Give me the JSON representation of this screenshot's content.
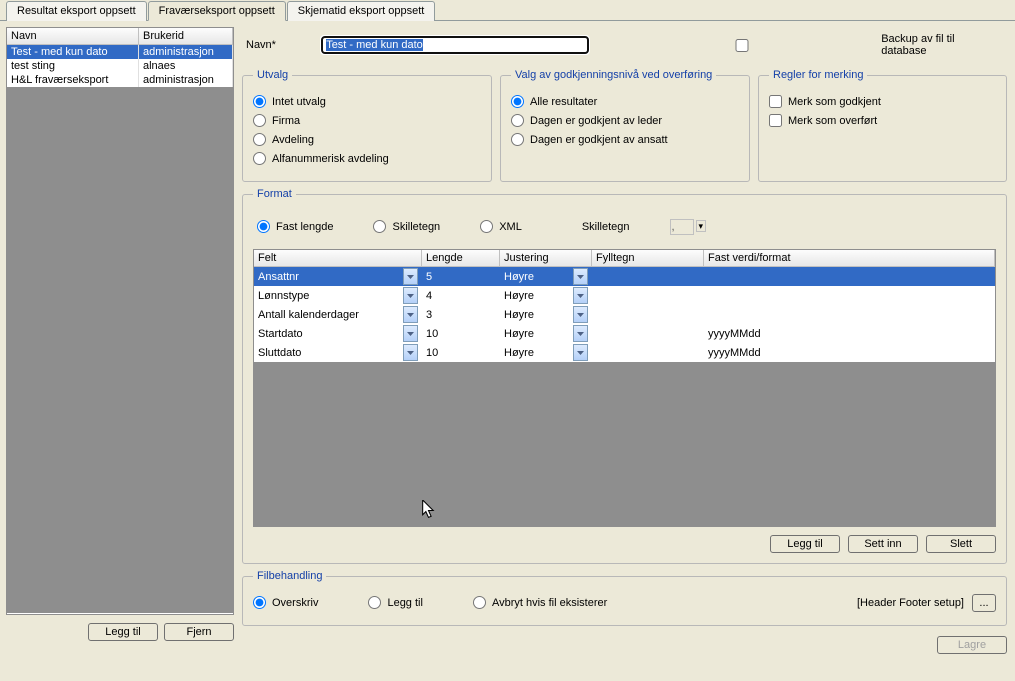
{
  "tabs": [
    "Resultat eksport oppsett",
    "Fraværseksport oppsett",
    "Skjematid eksport oppsett"
  ],
  "leftTable": {
    "headers": [
      "Navn",
      "Brukerid"
    ],
    "rows": [
      {
        "navn": "Test - med kun dato",
        "brukerid": "administrasjon"
      },
      {
        "navn": "test sting",
        "brukerid": "alnaes"
      },
      {
        "navn": "H&L fraværseksport",
        "brukerid": "administrasjon"
      }
    ]
  },
  "leftButtons": {
    "leggtil": "Legg til",
    "fjern": "Fjern"
  },
  "navn": {
    "label": "Navn*",
    "value": "Test - med kun dato"
  },
  "backup": {
    "label": "Backup av fil til database"
  },
  "utvalg": {
    "legend": "Utvalg",
    "options": [
      "Intet utvalg",
      "Firma",
      "Avdeling",
      "Alfanummerisk avdeling"
    ]
  },
  "valg": {
    "legend": "Valg av godkjenningsnivå ved overføring",
    "options": [
      "Alle resultater",
      "Dagen er godkjent av leder",
      "Dagen er godkjent av ansatt"
    ]
  },
  "regler": {
    "legend": "Regler for merking",
    "options": [
      "Merk som godkjent",
      "Merk som overført"
    ]
  },
  "format": {
    "legend": "Format",
    "radios": [
      "Fast lengde",
      "Skilletegn",
      "XML"
    ],
    "skilleLabel": "Skilletegn",
    "skilleValue": ",",
    "headers": [
      "Felt",
      "Lengde",
      "Justering",
      "Fylltegn",
      "Fast verdi/format"
    ],
    "rows": [
      {
        "felt": "Ansattnr",
        "lengde": "5",
        "just": "Høyre",
        "fyll": "",
        "fast": ""
      },
      {
        "felt": "Lønnstype",
        "lengde": "4",
        "just": "Høyre",
        "fyll": "",
        "fast": ""
      },
      {
        "felt": "Antall kalenderdager",
        "lengde": "3",
        "just": "Høyre",
        "fyll": "",
        "fast": ""
      },
      {
        "felt": "Startdato",
        "lengde": "10",
        "just": "Høyre",
        "fyll": "",
        "fast": "yyyyMMdd"
      },
      {
        "felt": "Sluttdato",
        "lengde": "10",
        "just": "Høyre",
        "fyll": "",
        "fast": "yyyyMMdd"
      }
    ],
    "buttons": {
      "leggtil": "Legg til",
      "settinn": "Sett inn",
      "slett": "Slett"
    }
  },
  "filbehandling": {
    "legend": "Filbehandling",
    "options": [
      "Overskriv",
      "Legg til",
      "Avbryt hvis fil eksisterer"
    ],
    "hfLabel": "[Header Footer setup]",
    "hfBtn": "..."
  },
  "lagre": "Lagre"
}
